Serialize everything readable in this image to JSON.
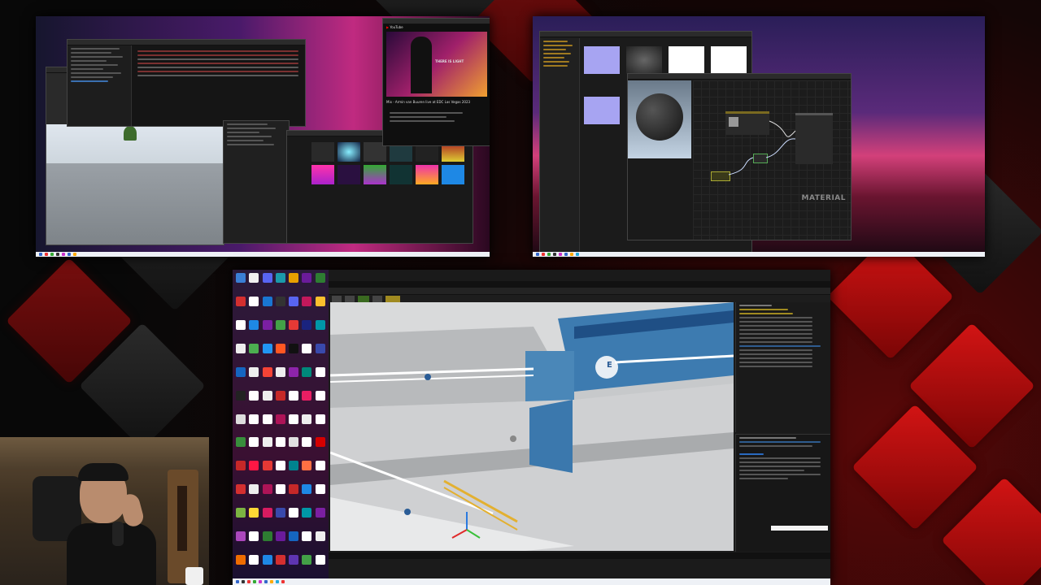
{
  "youtube": {
    "logo": "YouTube",
    "video_title": "Mix - Armin van Buuren live at EDC Las Vegas 2023",
    "thumb_text": "THERE IS LIGHT"
  },
  "material_editor": {
    "watermark": "MATERIAL"
  },
  "viewport": {
    "sign_text": "E",
    "gizmo_icon": "transform-gizmo-icon"
  },
  "colors": {
    "accent_red": "#d31414",
    "editor_dark": "#1b1b1b",
    "taskbar": "#eef1f6",
    "purple_sky": "#4a2a8a"
  },
  "icons": [
    "folder-icon",
    "chrome-icon",
    "steam-icon",
    "unreal-icon",
    "visual-studio-icon",
    "discord-icon",
    "photoshop-icon",
    "obs-icon",
    "blender-icon",
    "file-icon"
  ]
}
